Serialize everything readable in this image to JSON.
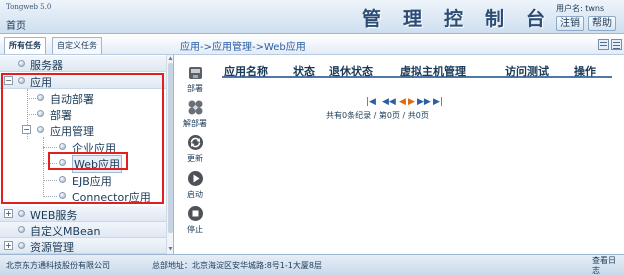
{
  "header": {
    "brand": "Tongweb 5.0",
    "home": "首页",
    "title": "管理控制台",
    "user": "用户名: twns",
    "logout": "注销",
    "help": "帮助"
  },
  "tabs": {
    "all_tasks": "所有任务",
    "custom_tasks": "自定义任务"
  },
  "breadcrumb": "应用->应用管理->Web应用",
  "sidebar": {
    "server": "服务器",
    "app": "应用",
    "auto_deploy": "自动部署",
    "deploy": "部署",
    "app_manage": "应用管理",
    "enterprise_app": "企业应用",
    "web_app": "Web应用",
    "ejb_app": "EJB应用",
    "connector_app": "Connector应用",
    "web_service": "WEB服务",
    "custom_mbean": "自定义MBean",
    "resource_manage": "资源管理"
  },
  "toolbar": {
    "deploy": "部署",
    "undeploy": "解部署",
    "update": "更新",
    "start": "启动",
    "stop": "停止"
  },
  "table": {
    "columns": [
      "应用名称",
      "状态",
      "退休状态",
      "虚拟主机管理",
      "访问测试",
      "操作"
    ]
  },
  "pager": {
    "info": "共有0条纪录 / 第0页 / 共0页"
  },
  "footer": {
    "company": "北京东方通科技股份有限公司",
    "address": "总部地址：北京海淀区安华城路:8号1-1大厦8层",
    "view": "查看日志"
  },
  "colors": {
    "accent": "#2b4d75",
    "highlight": "#e02020",
    "link": "#2a5fa5"
  }
}
